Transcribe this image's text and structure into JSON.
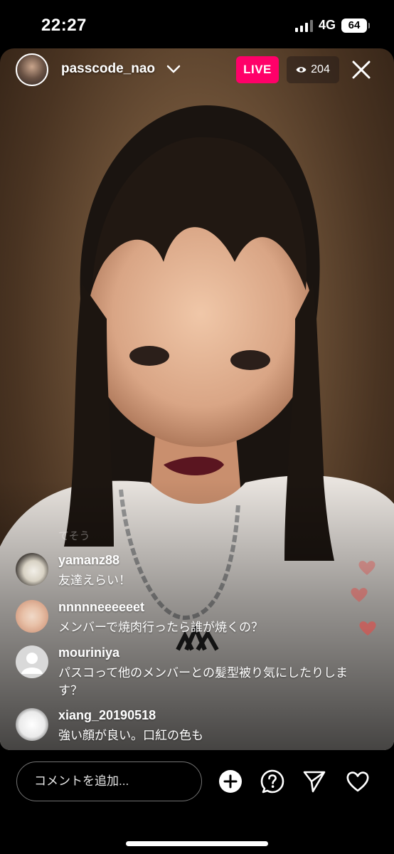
{
  "status_bar": {
    "time": "22:27",
    "network": "4G",
    "battery": "64"
  },
  "live": {
    "host_username": "passcode_nao",
    "live_label": "LIVE",
    "viewer_count": "204",
    "joined_hint": "てそう"
  },
  "comments": [
    {
      "username": "yamanz88",
      "text": "友達えらい！",
      "avatar": "cat-photo"
    },
    {
      "username": "nnnnneeeeeet",
      "text": "メンバーで焼肉行ったら誰が焼くの？",
      "avatar": "tulip-photo"
    },
    {
      "username": "mouriniya",
      "text": "パスコって他のメンバーとの髪型被り気にしたりします？",
      "avatar": "default-avatar"
    },
    {
      "username": "xiang_20190518",
      "text": "強い顔が良い。口紅の色も",
      "avatar": "illustration"
    }
  ],
  "bottom_bar": {
    "comment_placeholder": "コメントを追加..."
  },
  "colors": {
    "live_badge": "#ff0069",
    "heart": "#d9534f",
    "background": "#000000"
  },
  "icons": [
    "chevron-down-icon",
    "eye-icon",
    "close-icon",
    "plus-circle-icon",
    "question-icon",
    "send-icon",
    "heart-icon"
  ]
}
